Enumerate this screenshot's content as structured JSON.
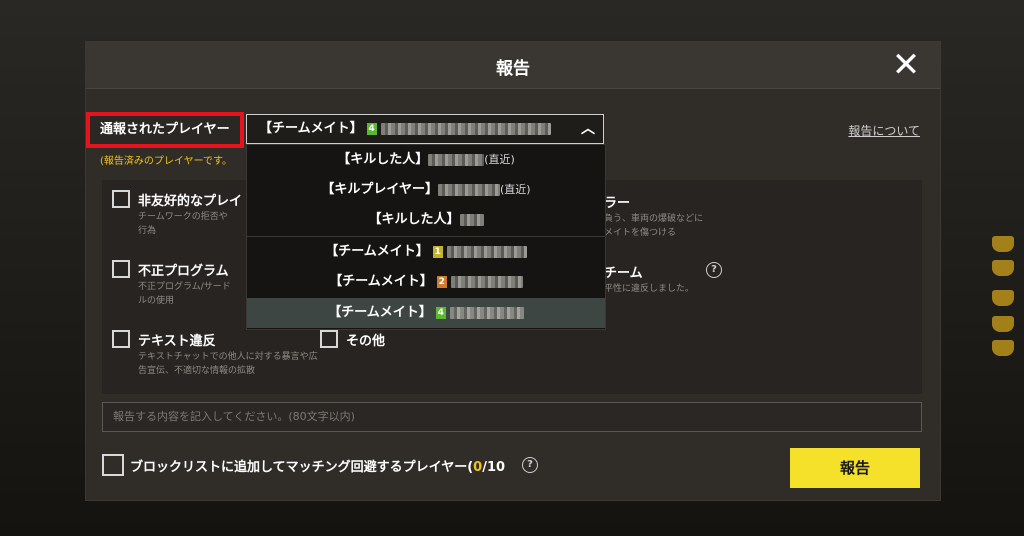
{
  "modal": {
    "title": "報告",
    "close_icon": "close-icon"
  },
  "reported": {
    "label": "通報されたプレイヤー",
    "note": "(報告済みのプレイヤーです。",
    "about_link": "報告について"
  },
  "select": {
    "value_prefix": "【チームメイト】",
    "badge": "4",
    "badge_color": "#5cb82e"
  },
  "dropdown": {
    "items": [
      {
        "label": "【キルした人】",
        "suffix": "(直近)"
      },
      {
        "label": "【キルプレイヤー】",
        "suffix": "(直近)"
      },
      {
        "label": "【キルした人】",
        "suffix": ""
      },
      {
        "label": "【チームメイト】",
        "badge": "1",
        "badge_color": "#c4b32a"
      },
      {
        "label": "【チームメイト】",
        "badge": "2",
        "badge_color": "#d07a2e"
      },
      {
        "label": "【チームメイト】",
        "badge": "4",
        "badge_color": "#5cb82e"
      }
    ]
  },
  "options": {
    "unfriendly": {
      "title": "非友好的なプレイ",
      "desc": "チームワークの拒否や"
    },
    "unfriendly_desc2": "行為",
    "cheat": {
      "title": "不正プログラム",
      "desc": "不正プログラム/サード"
    },
    "cheat_desc2": "ルの使用",
    "text": {
      "title": "テキスト違反",
      "desc": "テキストチャットでの他人に対する暴言や広告宣伝、不適切な情報の拡散"
    },
    "other": {
      "title": "その他"
    },
    "right1": {
      "title": "ラー",
      "desc1": "負う、車両の爆破などに",
      "desc2": "メイトを傷つける"
    },
    "right2": {
      "title": "チーム",
      "desc": "平性に違反しました。"
    }
  },
  "text_input": {
    "placeholder": "報告する内容を記入してください。(80文字以内)"
  },
  "block": {
    "label": "ブロックリストに追加してマッチング回避するプレイヤー(",
    "count_current": "0",
    "count_total": "/10"
  },
  "report_button": "報告",
  "colors": {
    "accent_yellow": "#f5e12a",
    "highlight_red": "#e5141c"
  }
}
